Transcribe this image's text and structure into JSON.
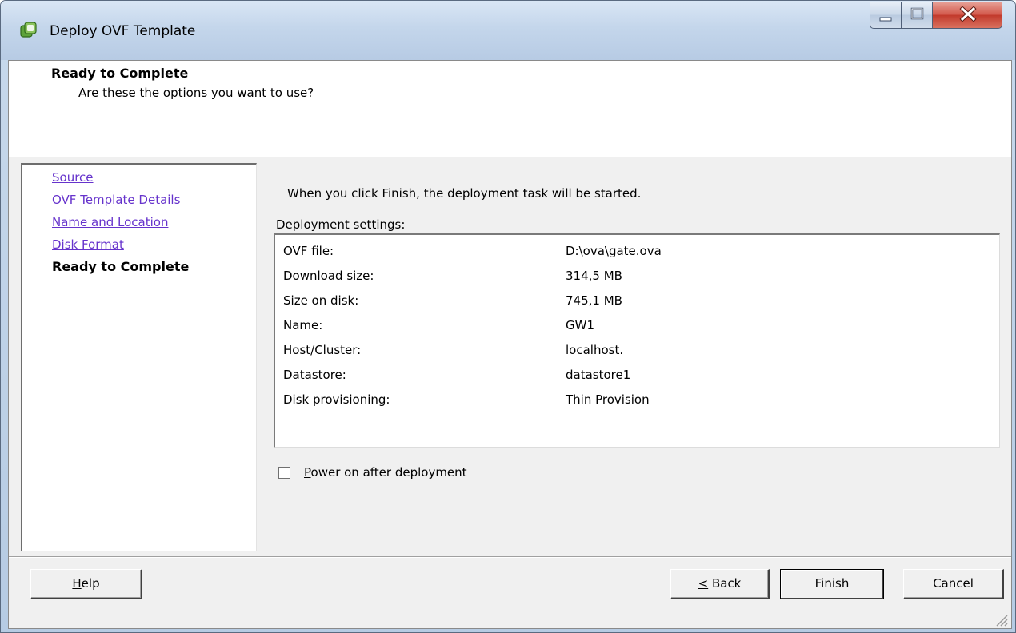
{
  "window": {
    "title": "Deploy OVF Template"
  },
  "header": {
    "title": "Ready to Complete",
    "subtitle": "Are these the options you want to use?"
  },
  "nav": {
    "items": [
      {
        "label": "Source"
      },
      {
        "label": "OVF Template Details"
      },
      {
        "label": "Name and Location"
      },
      {
        "label": "Disk Format"
      }
    ],
    "current": "Ready to Complete"
  },
  "main": {
    "info": "When you click Finish, the deployment task will be started.",
    "settings_label": "Deployment settings:",
    "settings": [
      {
        "key": "OVF file:",
        "value": "D:\\ova\\gate.ova"
      },
      {
        "key": "Download size:",
        "value": "314,5 MB"
      },
      {
        "key": "Size on disk:",
        "value": "745,1 MB"
      },
      {
        "key": "Name:",
        "value": "GW1"
      },
      {
        "key": "Host/Cluster:",
        "value": "localhost."
      },
      {
        "key": "Datastore:",
        "value": "datastore1"
      },
      {
        "key": "Disk provisioning:",
        "value": "Thin Provision"
      }
    ],
    "power_on": {
      "label_prefix": "P",
      "label_rest": "ower on after deployment",
      "checked": false
    }
  },
  "buttons": {
    "help_prefix": "H",
    "help_rest": "elp",
    "back_prefix": "<",
    "back_rest": " Back",
    "finish": "Finish",
    "cancel": "Cancel"
  }
}
